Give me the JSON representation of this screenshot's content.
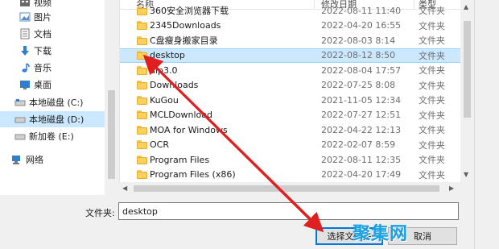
{
  "nav": {
    "items": [
      {
        "label": "视频",
        "icon": "video-folder-icon"
      },
      {
        "label": "图片",
        "icon": "pictures-folder-icon"
      },
      {
        "label": "文档",
        "icon": "documents-folder-icon"
      },
      {
        "label": "下载",
        "icon": "downloads-folder-icon"
      },
      {
        "label": "音乐",
        "icon": "music-folder-icon"
      },
      {
        "label": "桌面",
        "icon": "desktop-folder-icon"
      },
      {
        "label": "本地磁盘 (C:)",
        "icon": "drive-icon"
      },
      {
        "label": "本地磁盘 (D:)",
        "icon": "drive-icon",
        "selected": true
      },
      {
        "label": "新加卷 (E:)",
        "icon": "drive-icon"
      },
      {
        "label": "网络",
        "icon": "network-icon"
      }
    ]
  },
  "list": {
    "headers": {
      "name": "名称",
      "date": "修改日期",
      "type": "类型"
    },
    "rows": [
      {
        "name": "360安全浏览器下载",
        "date": "2022-08-11 11:40",
        "type": "文件夹"
      },
      {
        "name": "2345Downloads",
        "date": "2022-04-20 16:55",
        "type": "文件夹"
      },
      {
        "name": "C盘瘦身搬家目录",
        "date": "2022-08-03 8:14",
        "type": "文件夹"
      },
      {
        "name": "desktop",
        "date": "2022-08-12 8:50",
        "type": "文件夹",
        "selected": true
      },
      {
        "name": "dlp3.0",
        "date": "2022-08-04 17:57",
        "type": "文件夹"
      },
      {
        "name": "Downloads",
        "date": "2022-07-25 8:08",
        "type": "文件夹"
      },
      {
        "name": "KuGou",
        "date": "2021-11-05 12:34",
        "type": "文件夹"
      },
      {
        "name": "MCLDownload",
        "date": "2022-07-27 12:51",
        "type": "文件夹"
      },
      {
        "name": "MOA for Windows",
        "date": "2022-04-22 12:13",
        "type": "文件夹"
      },
      {
        "name": "OCR",
        "date": "2022-02-07 8:59",
        "type": "文件夹"
      },
      {
        "name": "Program Files",
        "date": "2022-08-11 12:35",
        "type": "文件夹"
      },
      {
        "name": "Program Files (x86)",
        "date": "2022-04-20 17:49",
        "type": "文件夹"
      }
    ]
  },
  "footer": {
    "folder_label": "文件夹:",
    "folder_value": "desktop",
    "select_button": "选择文件夹",
    "cancel_button": "取消"
  },
  "watermark": "聚集网",
  "colors": {
    "selection": "#cce8ff",
    "arrow": "#e02020",
    "accent": "#0078d7"
  }
}
